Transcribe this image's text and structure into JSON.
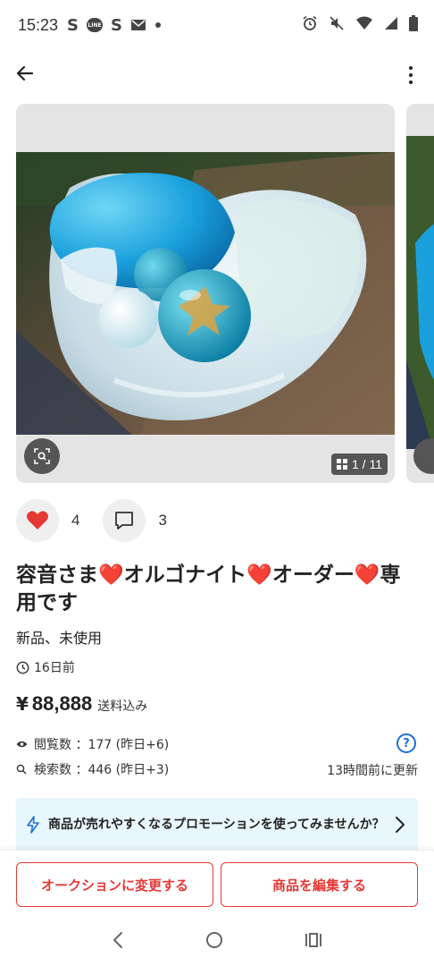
{
  "status_bar": {
    "time": "15:23",
    "notification_icons": [
      "s-icon",
      "line-icon",
      "s-icon",
      "mail-icon",
      "dot-icon"
    ],
    "line_badge_text": "LINE",
    "status_icons": [
      "alarm-icon",
      "mute-icon",
      "wifi-icon",
      "signal-icon",
      "battery-icon"
    ]
  },
  "carousel": {
    "counter": "1 / 11",
    "colors": {
      "card_bg": "#e4e4e4",
      "overlay_btn": "#555555"
    }
  },
  "reactions": {
    "likes": "4",
    "comments": "3"
  },
  "product": {
    "title": "容音さま❤️オルゴナイト❤️オーダー❤️専用です",
    "condition": "新品、未使用",
    "posted": "16日前",
    "currency": "¥",
    "price": "88,888",
    "shipping": "送料込み"
  },
  "stats": {
    "views": "閲覧数 ：177 (昨日+6)",
    "searches": "検索数 ：446 (昨日+3)",
    "updated": "13時間前に更新"
  },
  "promo": {
    "text": "商品が売れやすくなるプロモーションを使ってみませんか？"
  },
  "actions": {
    "auction_label": "オークションに変更する",
    "edit_label": "商品を編集する"
  },
  "colors": {
    "accent_red": "#e53935",
    "link_blue": "#1e6fd9",
    "promo_bg": "#e8f6fd"
  }
}
